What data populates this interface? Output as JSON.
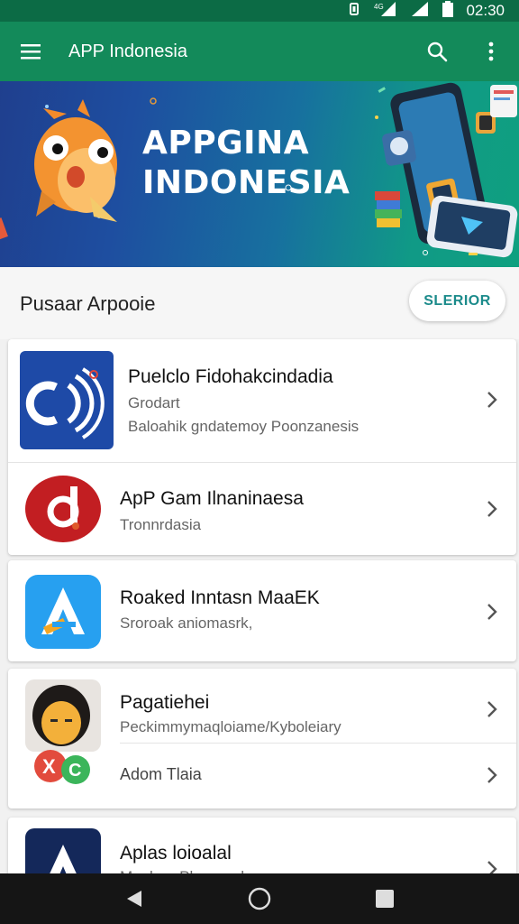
{
  "status_bar": {
    "time": "02:30"
  },
  "app_bar": {
    "title": "APP Indonesia"
  },
  "banner": {
    "line1": "APPGINA",
    "line2": "INDONESIA"
  },
  "section": {
    "title": "Pusaar Arpooie",
    "button_label": "SLERIOR"
  },
  "apps": [
    {
      "name": "Puelclo Fidohakcindadia",
      "line1": "Grodart",
      "line2": "Baloahik gndatemoy Poonzanesis"
    },
    {
      "name": "ApP Gam Ilnaninaesa",
      "line1": "Tronnrdasia"
    },
    {
      "name": "Roaked Inntasn MaaEK",
      "line1": "Sroroak aniomasrk,"
    },
    {
      "name": "Pagatiehei",
      "line1": "Peckimmymaqloiame/Kyboleiary",
      "line2": "Adom Tlaia"
    },
    {
      "name": "Aplas loioalal",
      "line1": "Mm boa Pbananaha"
    }
  ],
  "colors": {
    "status_bar": "#0c6b45",
    "app_bar": "#138a5a",
    "accent": "#1c8b8b",
    "nav_bar": "#151515"
  }
}
